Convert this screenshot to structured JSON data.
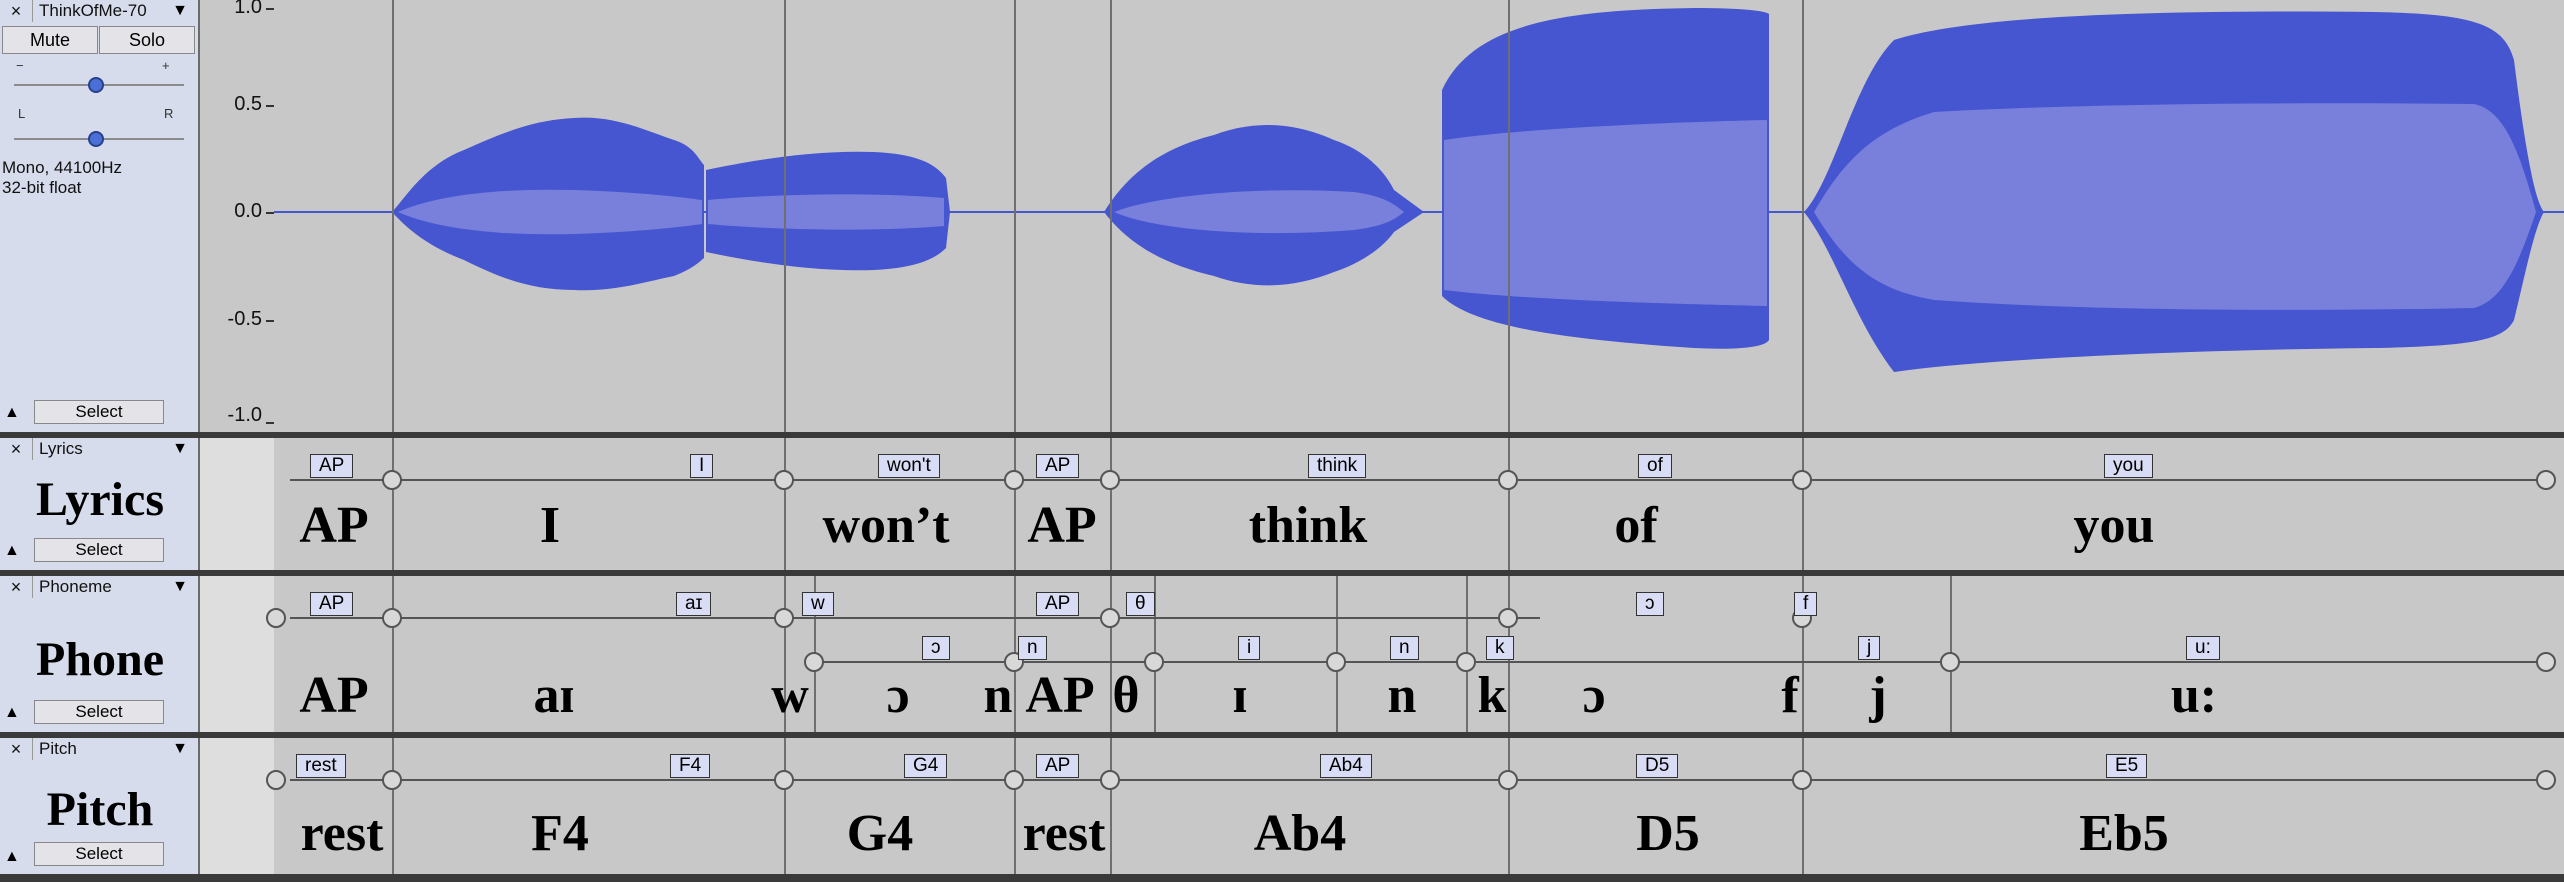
{
  "audio_track": {
    "close_icon": "close-icon",
    "name": "ThinkOfMe-70",
    "dropdown_icon": "triangle-down-icon",
    "mute_label": "Mute",
    "solo_label": "Solo",
    "gain_minus": "−",
    "gain_plus": "+",
    "pan_left": "L",
    "pan_right": "R",
    "info_line1": "Mono, 44100Hz",
    "info_line2": "32-bit float",
    "select_label": "Select",
    "gain_level": 0.55,
    "pan_level": 0.5
  },
  "ruler": [
    "1.0",
    "0.5",
    "0.0",
    "-0.5",
    "-1.0"
  ],
  "colors": {
    "wave_outer": "#4655d0",
    "wave_inner": "#7880dc",
    "panel_bg": "#d6dceb",
    "lane_bg": "#c8c8c8"
  },
  "lyrics_track": {
    "menu_name": "Lyrics",
    "big_label": "Lyrics",
    "select_label": "Select",
    "tags": [
      "AP",
      "I",
      "won't",
      "AP",
      "think",
      "of",
      "you"
    ],
    "texts": [
      "AP",
      "I",
      "won’t",
      "AP",
      "think",
      "of",
      "you"
    ]
  },
  "phoneme_track": {
    "menu_name": "Phoneme",
    "big_label": "Phone",
    "select_label": "Select",
    "upper_tags": [
      "AP",
      "aɪ",
      "w",
      "AP",
      "θ",
      "ɔ",
      "f"
    ],
    "lower_tags": [
      "ɔ",
      "n",
      "i",
      "n",
      "k",
      "j",
      "u:"
    ],
    "texts": [
      "AP",
      "aɪ",
      "w",
      "ɔ",
      "n",
      "AP",
      "θ",
      "ɪ",
      "n",
      "k",
      "ɔ",
      "f",
      "j",
      "u:"
    ]
  },
  "pitch_track": {
    "menu_name": "Pitch",
    "big_label": "Pitch",
    "select_label": "Select",
    "tags": [
      "rest",
      "F4",
      "G4",
      "AP",
      "Ab4",
      "D5",
      "E5"
    ],
    "texts": [
      "rest",
      "F4",
      "G4",
      "rest",
      "Ab4",
      "D5",
      "Eb5"
    ]
  }
}
